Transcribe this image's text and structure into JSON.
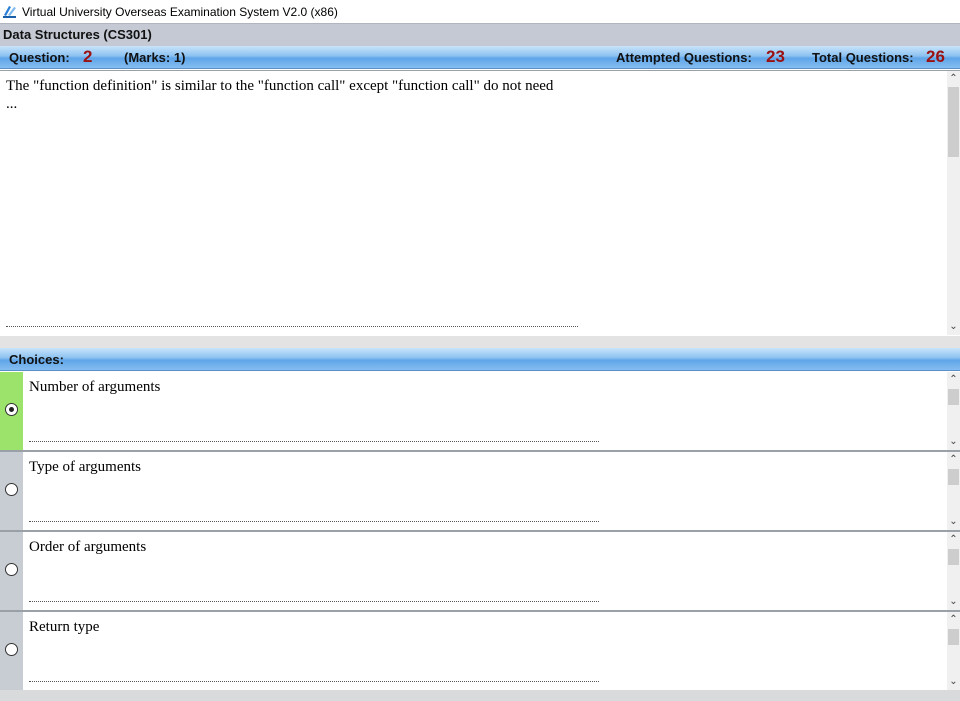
{
  "window": {
    "title": "Virtual University Overseas Examination System  V2.0 (x86)",
    "icon": "vu-logo-icon"
  },
  "course": {
    "title": "Data Structures  (CS301)"
  },
  "question_bar": {
    "question_label": "Question:",
    "question_number": "2",
    "marks": "(Marks: 1)",
    "attempted_label": "Attempted Questions:",
    "attempted_value": "23",
    "total_label": "Total Questions:",
    "total_value": "26"
  },
  "question": {
    "text": "The \"function definition\" is similar to the \"function call\"  except \"function call\"  do not need ..."
  },
  "choices_header": "Choices:",
  "choices": [
    {
      "text": "Number of arguments",
      "selected": true
    },
    {
      "text": "Type of arguments",
      "selected": false
    },
    {
      "text": "Order of arguments",
      "selected": false
    },
    {
      "text": "Return type",
      "selected": false
    }
  ],
  "colors": {
    "accent_number": "#9b1010",
    "selected_choice": "#9be36b",
    "header_bar": "#5fa5e8"
  }
}
